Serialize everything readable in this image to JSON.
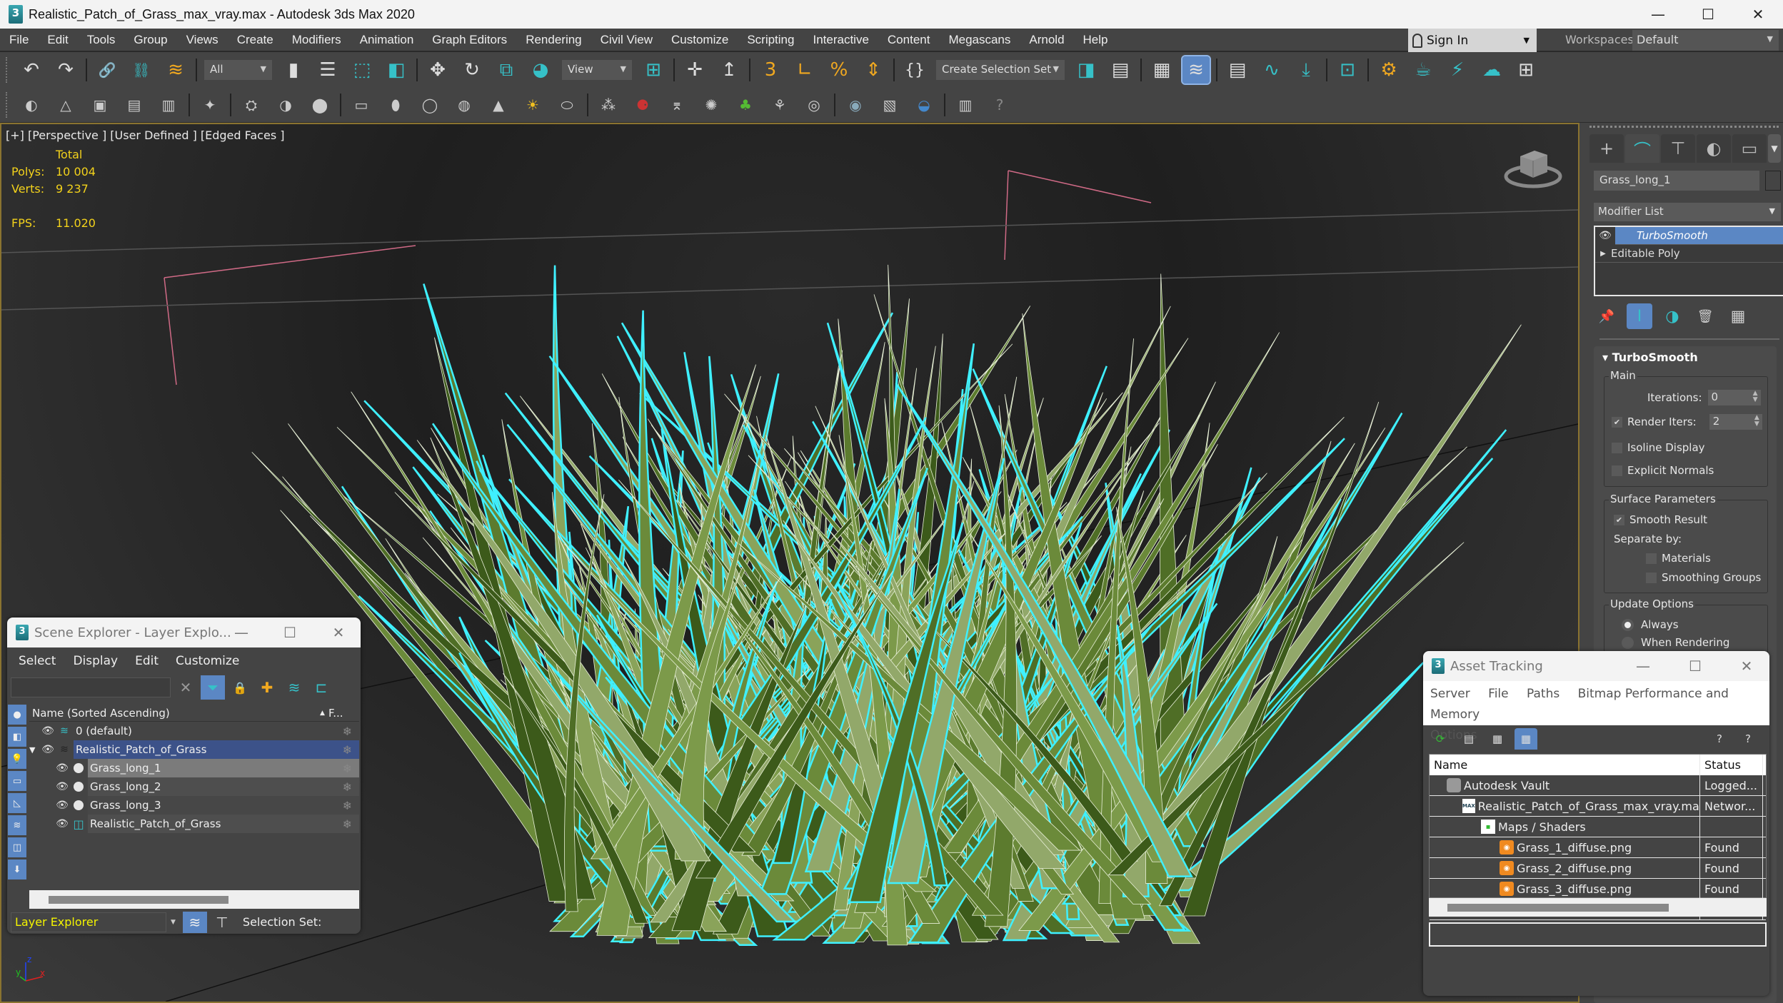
{
  "window": {
    "title": "Realistic_Patch_of_Grass_max_vray.max - Autodesk 3ds Max 2020",
    "app_icon_glyph": "3",
    "controls": {
      "minimize": "—",
      "maximize": "☐",
      "close": "✕"
    }
  },
  "menubar": {
    "items": [
      "File",
      "Edit",
      "Tools",
      "Group",
      "Views",
      "Create",
      "Modifiers",
      "Animation",
      "Graph Editors",
      "Rendering",
      "Civil View",
      "Customize",
      "Scripting",
      "Interactive",
      "Content",
      "Megascans",
      "Arnold",
      "Help"
    ],
    "sign_in": "Sign In",
    "workspaces_label": "Workspaces:",
    "workspaces_value": "Default"
  },
  "toolbar_main": {
    "selection_filter": "All",
    "reference_coord": "View",
    "named_selection": "Create Selection Set",
    "icons": {
      "undo": "↶",
      "redo": "↷",
      "link": "🔗",
      "unlink": "⛓",
      "bind_space_warp": "≋",
      "select": "▮",
      "select_by_name": "☰",
      "rect_region": "⬚",
      "window_crossing": "◧",
      "move": "✥",
      "rotate": "↻",
      "scale": "⧉",
      "placement": "◕",
      "pivot": "⊞",
      "keyboard_shortcut": "✛",
      "snaps": "↥",
      "snap_3d": "3",
      "angle_snap": "∟",
      "percent_snap": "%",
      "spinner_snap": "⇕",
      "edit_named_sel": "{}",
      "mirror": "◨",
      "align": "▤",
      "scene_explorer_toggle": "▦",
      "layer_explorer": "≋",
      "toggle_ribbon": "▤",
      "curve_editor": "∿",
      "dope_sheet": "⤓",
      "schematic_view": "⊡",
      "material_editor": "⚙",
      "render_setup": "☕",
      "rendered_frame": "⚡",
      "render_cloud": "☁",
      "viewport_layouts": "⊞"
    }
  },
  "toolbar_secondary": {
    "icons": [
      "◐",
      "△",
      "▣",
      "▤",
      "▥",
      "✦",
      "⛭",
      "◑",
      "⬤",
      "▭",
      "⬮",
      "◯",
      "◍",
      "▲",
      "☀",
      "⬭",
      "⁂",
      "⚈",
      "⌆",
      "✺",
      "♣",
      "⚘",
      "◎",
      "◉",
      "▧",
      "◒",
      "▥",
      "?"
    ]
  },
  "viewport": {
    "label": "[+] [Perspective ] [User Defined ] [Edged Faces ]",
    "stats": {
      "header": "Total",
      "polys_label": "Polys:",
      "polys_value": "10 004",
      "verts_label": "Verts:",
      "verts_value": "9 237",
      "fps_label": "FPS:",
      "fps_value": "11.020"
    },
    "axis": {
      "x": "x",
      "y": "y",
      "z": "z"
    }
  },
  "command_panel": {
    "tabs": [
      "+",
      "⌒",
      "⊤",
      "◐",
      "▭",
      "⌇"
    ],
    "object_name": "Grass_long_1",
    "modifier_list_label": "Modifier List",
    "stack": [
      {
        "label": "TurboSmooth",
        "selected": true
      },
      {
        "label": "Editable Poly",
        "selected": false
      }
    ],
    "stack_tool_icons": {
      "pin": "📌",
      "show_end": "Ⅰ",
      "make_unique": "◑",
      "remove": "🗑",
      "configure": "▦"
    },
    "rollout": {
      "title": "TurboSmooth",
      "main_group": "Main",
      "iterations_label": "Iterations:",
      "iterations_value": "0",
      "render_iters_label": "Render Iters:",
      "render_iters_value": "2",
      "render_iters_checked": true,
      "isoline_display": "Isoline Display",
      "isoline_checked": false,
      "explicit_normals": "Explicit Normals",
      "explicit_normals_checked": false,
      "surface_group": "Surface Parameters",
      "smooth_result": "Smooth Result",
      "smooth_result_checked": true,
      "separate_by": "Separate by:",
      "materials": "Materials",
      "materials_checked": false,
      "smoothing_groups": "Smoothing Groups",
      "smoothing_groups_checked": false,
      "update_group": "Update Options",
      "update_always": "Always",
      "update_when_rendering": "When Rendering",
      "update_selected": "Always"
    }
  },
  "scene_explorer": {
    "title": "Scene Explorer - Layer Explo...",
    "menu": [
      "Select",
      "Display",
      "Edit",
      "Customize"
    ],
    "search_value": "",
    "column_name": "Name (Sorted Ascending)",
    "column_frozen": "F...",
    "rows": [
      {
        "name": "0 (default)",
        "indent": 1,
        "type": "layer",
        "expanded": false
      },
      {
        "name": "Realistic_Patch_of_Grass",
        "indent": 1,
        "type": "layer",
        "expanded": true,
        "highlight": "layer"
      },
      {
        "name": "Grass_long_1",
        "indent": 2,
        "type": "object",
        "highlight": "selected"
      },
      {
        "name": "Grass_long_2",
        "indent": 2,
        "type": "object"
      },
      {
        "name": "Grass_long_3",
        "indent": 2,
        "type": "object"
      },
      {
        "name": "Realistic_Patch_of_Grass",
        "indent": 2,
        "type": "group"
      }
    ],
    "explorer_type": "Layer Explorer",
    "selection_set_label": "Selection Set:"
  },
  "asset_tracking": {
    "title": "Asset Tracking",
    "menu": [
      "Server",
      "File",
      "Paths",
      "Bitmap Performance and Memory",
      "Options"
    ],
    "columns": {
      "name": "Name",
      "status": "Status"
    },
    "rows": [
      {
        "name": "Autodesk Vault",
        "status": "Logged...",
        "indent": 1,
        "icon": "vault"
      },
      {
        "name": "Realistic_Patch_of_Grass_max_vray.max",
        "status": "Networ...",
        "indent": 2,
        "icon": "maxfile"
      },
      {
        "name": "Maps / Shaders",
        "status": "",
        "indent": 3,
        "icon": "maps"
      },
      {
        "name": "Grass_1_diffuse.png",
        "status": "Found",
        "indent": 4,
        "icon": "png"
      },
      {
        "name": "Grass_2_diffuse.png",
        "status": "Found",
        "indent": 4,
        "icon": "png"
      },
      {
        "name": "Grass_3_diffuse.png",
        "status": "Found",
        "indent": 4,
        "icon": "png"
      }
    ]
  },
  "colors": {
    "accent_blue": "#5b87c4",
    "teal": "#36c1c8",
    "stats_yellow": "#f3d21b",
    "viewport_border": "#8a7330",
    "selection_cyan": "#3ff0ff",
    "grass_green": "#6b8a3a"
  }
}
